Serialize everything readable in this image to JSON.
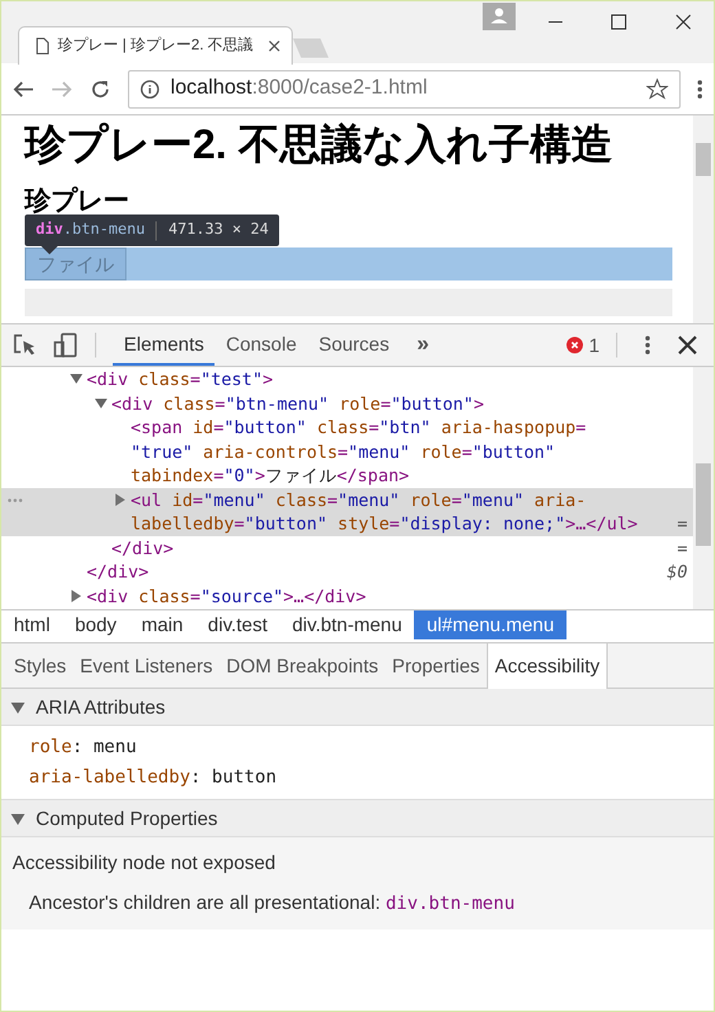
{
  "browser": {
    "tab_title": "珍プレー | 珍プレー2. 不思議",
    "url_host": "localhost",
    "url_path": ":8000/case2-1.html"
  },
  "page": {
    "heading": "珍プレー2. 不思議な入れ子構造",
    "subheading": "珍プレー",
    "tooltip": {
      "tag": "div",
      "class": ".btn-menu",
      "size": "471.33 × 24"
    },
    "menu_button": "ファイル"
  },
  "devtools": {
    "tabs": [
      {
        "label": "Elements",
        "selected": true
      },
      {
        "label": "Console",
        "selected": false
      },
      {
        "label": "Sources",
        "selected": false
      }
    ],
    "more": "»",
    "error_count": "1",
    "dom": [
      {
        "expanded": true,
        "selected": false,
        "lines": [
          [
            {
              "kind": "tag",
              "text": "<div "
            },
            {
              "kind": "attr",
              "text": "class"
            },
            {
              "kind": "tag",
              "text": "="
            },
            {
              "kind": "value",
              "text": "\"test\""
            },
            {
              "kind": "tag",
              "text": ">"
            }
          ]
        ],
        "children": [
          {
            "expanded": true,
            "selected": false,
            "lines": [
              [
                {
                  "kind": "tag",
                  "text": "<div "
                },
                {
                  "kind": "attr",
                  "text": "class"
                },
                {
                  "kind": "tag",
                  "text": "="
                },
                {
                  "kind": "value",
                  "text": "\"btn-menu\""
                },
                {
                  "kind": "attr",
                  "text": " role"
                },
                {
                  "kind": "tag",
                  "text": "="
                },
                {
                  "kind": "value",
                  "text": "\"button\""
                },
                {
                  "kind": "tag",
                  "text": ">"
                }
              ]
            ],
            "children": [
              {
                "selected": false,
                "lines": [
                  [
                    {
                      "kind": "tag",
                      "text": "<span "
                    },
                    {
                      "kind": "attr",
                      "text": "id"
                    },
                    {
                      "kind": "tag",
                      "text": "="
                    },
                    {
                      "kind": "value",
                      "text": "\"button\""
                    },
                    {
                      "kind": "attr",
                      "text": " class"
                    },
                    {
                      "kind": "tag",
                      "text": "="
                    },
                    {
                      "kind": "value",
                      "text": "\"btn\""
                    },
                    {
                      "kind": "attr",
                      "text": " aria-haspopup"
                    },
                    {
                      "kind": "tag",
                      "text": "="
                    }
                  ],
                  [
                    {
                      "kind": "value",
                      "text": "\"true\""
                    },
                    {
                      "kind": "attr",
                      "text": " aria-controls"
                    },
                    {
                      "kind": "tag",
                      "text": "="
                    },
                    {
                      "kind": "value",
                      "text": "\"menu\""
                    },
                    {
                      "kind": "attr",
                      "text": " role"
                    },
                    {
                      "kind": "tag",
                      "text": "="
                    },
                    {
                      "kind": "value",
                      "text": "\"button\""
                    }
                  ],
                  [
                    {
                      "kind": "attr",
                      "text": "tabindex"
                    },
                    {
                      "kind": "tag",
                      "text": "="
                    },
                    {
                      "kind": "value",
                      "text": "\"0\""
                    },
                    {
                      "kind": "tag",
                      "text": ">"
                    },
                    {
                      "kind": "text",
                      "text": "ファイル"
                    },
                    {
                      "kind": "tag",
                      "text": "</span>"
                    }
                  ]
                ]
              },
              {
                "expanded": false,
                "selected": true,
                "lines": [
                  [
                    {
                      "kind": "tag",
                      "text": "<ul "
                    },
                    {
                      "kind": "attr",
                      "text": "id"
                    },
                    {
                      "kind": "tag",
                      "text": "="
                    },
                    {
                      "kind": "value",
                      "text": "\"menu\""
                    },
                    {
                      "kind": "attr",
                      "text": " class"
                    },
                    {
                      "kind": "tag",
                      "text": "="
                    },
                    {
                      "kind": "value",
                      "text": "\"menu\""
                    },
                    {
                      "kind": "attr",
                      "text": " role"
                    },
                    {
                      "kind": "tag",
                      "text": "="
                    },
                    {
                      "kind": "value",
                      "text": "\"menu\""
                    },
                    {
                      "kind": "attr",
                      "text": " aria-"
                    }
                  ],
                  [
                    {
                      "kind": "attr",
                      "text": "labelledby"
                    },
                    {
                      "kind": "tag",
                      "text": "="
                    },
                    {
                      "kind": "value",
                      "text": "\"button\""
                    },
                    {
                      "kind": "attr",
                      "text": " style"
                    },
                    {
                      "kind": "tag",
                      "text": "="
                    },
                    {
                      "kind": "value",
                      "text": "\"display: none;\""
                    },
                    {
                      "kind": "tag",
                      "text": ">…</ul>"
                    }
                  ]
                ]
              }
            ],
            "closing": "</div>"
          }
        ],
        "closing": "</div>"
      },
      {
        "expanded": false,
        "selected": false,
        "lines": [
          [
            {
              "kind": "tag",
              "text": "<div "
            },
            {
              "kind": "attr",
              "text": "class"
            },
            {
              "kind": "tag",
              "text": "="
            },
            {
              "kind": "value",
              "text": "\"source\""
            },
            {
              "kind": "tag",
              "text": ">…</div>"
            }
          ]
        ]
      }
    ],
    "selected_marker": [
      "=",
      "=",
      "$0"
    ],
    "breadcrumbs": [
      {
        "label": "html",
        "selected": false
      },
      {
        "label": "body",
        "selected": false
      },
      {
        "label": "main",
        "selected": false
      },
      {
        "label": "div.test",
        "selected": false
      },
      {
        "label": "div.btn-menu",
        "selected": false
      },
      {
        "label": "ul#menu.menu",
        "selected": true
      }
    ],
    "sidebar_tabs": [
      {
        "label": "Styles",
        "selected": false
      },
      {
        "label": "Event Listeners",
        "selected": false
      },
      {
        "label": "DOM Breakpoints",
        "selected": false
      },
      {
        "label": "Properties",
        "selected": false
      },
      {
        "label": "Accessibility",
        "selected": true
      }
    ],
    "sections": [
      {
        "kind": "attributes",
        "title": "ARIA Attributes",
        "expanded": true,
        "rows": [
          {
            "name": "role",
            "separator": ":",
            "value": "menu"
          },
          {
            "name": "aria-labelledby",
            "separator": ":",
            "value": "button"
          }
        ]
      },
      {
        "kind": "computed",
        "title": "Computed Properties",
        "expanded": true,
        "message": "Accessibility node not exposed",
        "reason": "Ancestor's children are all presentational:",
        "reason_link": "div.btn-menu"
      }
    ]
  }
}
